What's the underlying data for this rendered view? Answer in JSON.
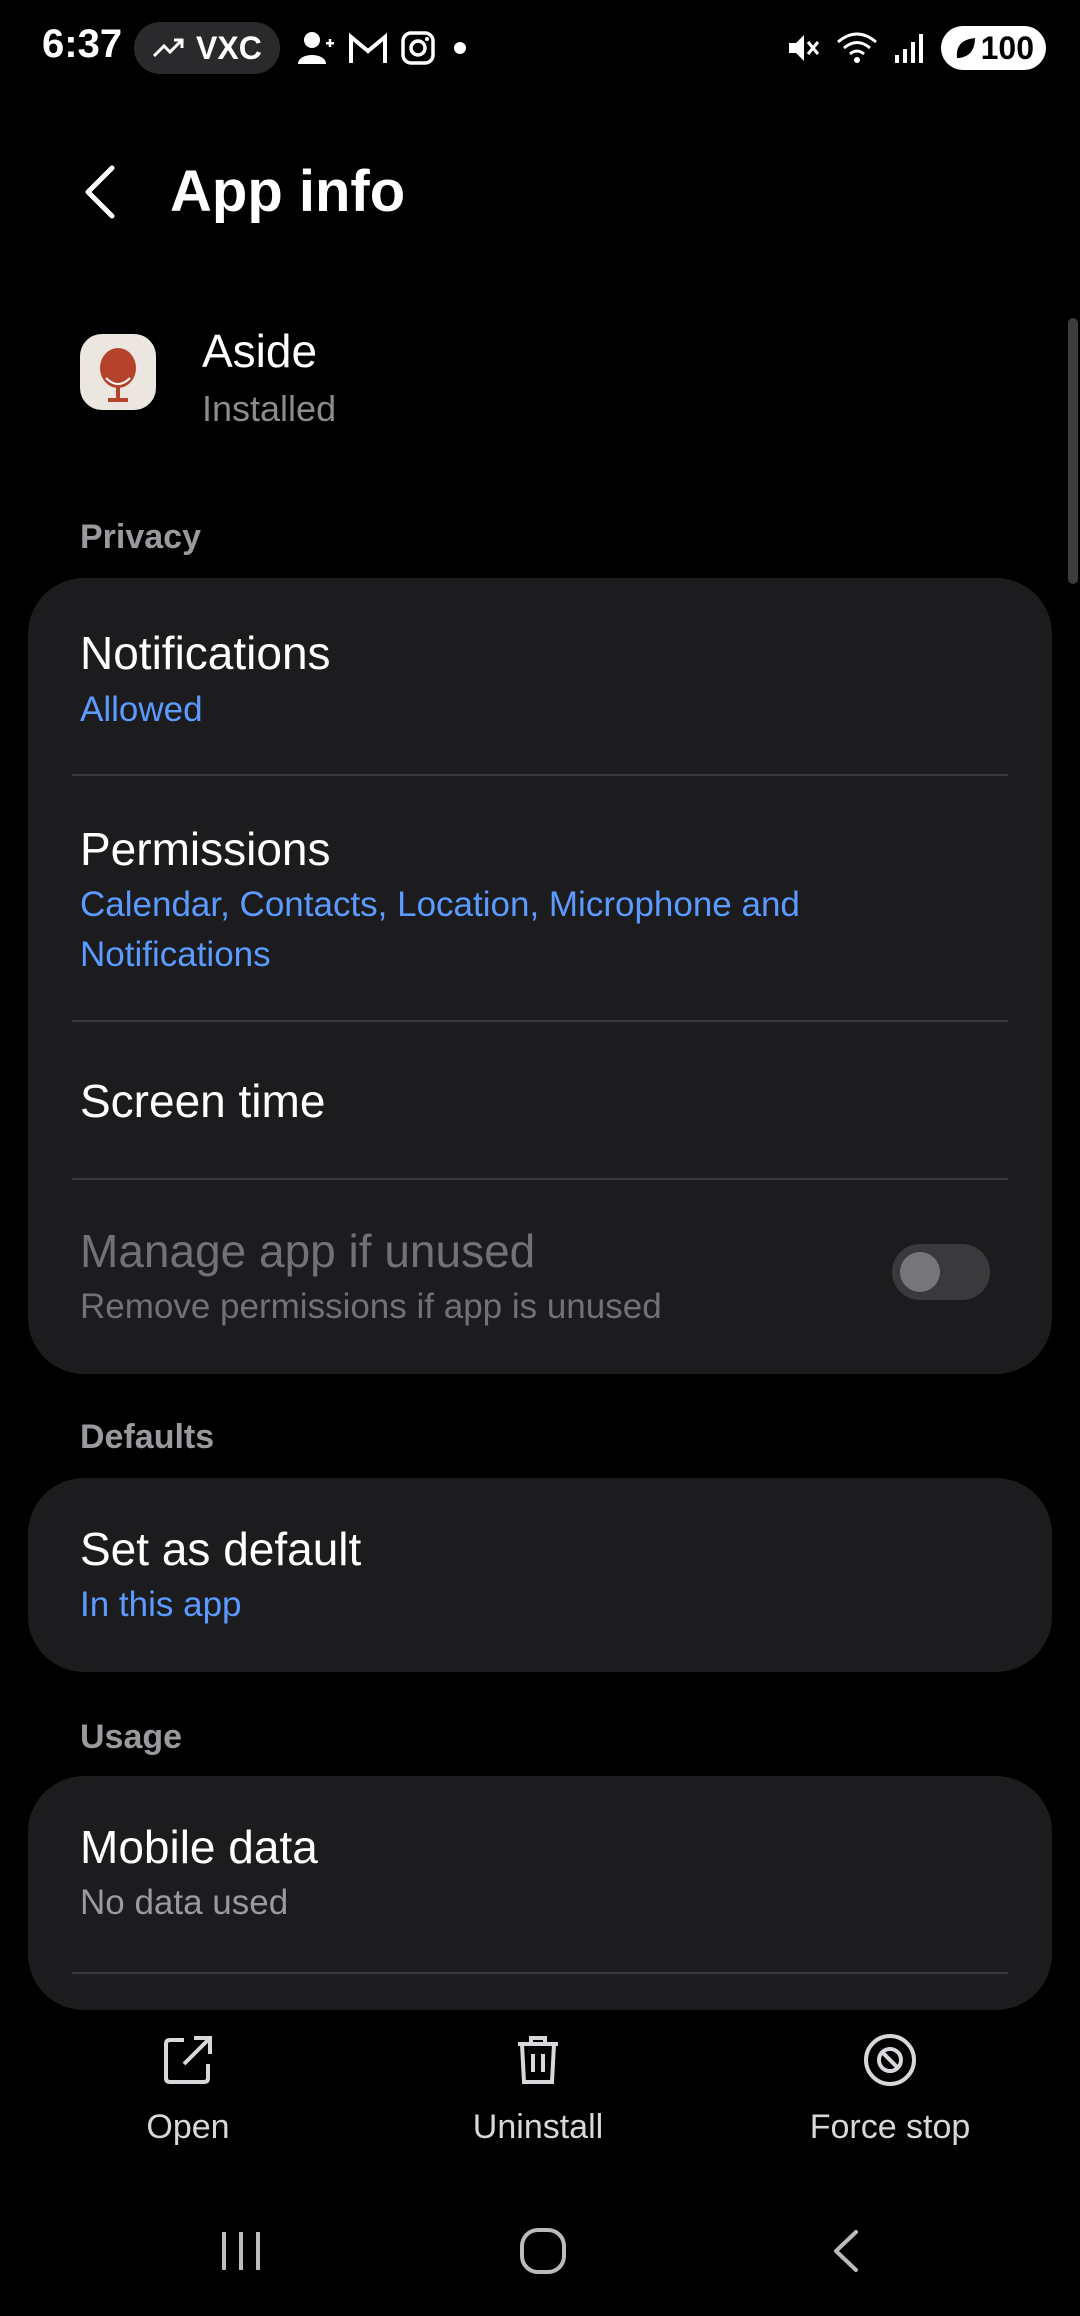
{
  "status_bar": {
    "time": "6:37",
    "pill_text": "VXC",
    "battery": "100"
  },
  "header": {
    "title": "App info"
  },
  "app": {
    "name": "Aside",
    "status": "Installed"
  },
  "sections": {
    "privacy": "Privacy",
    "defaults": "Defaults",
    "usage": "Usage"
  },
  "privacy_items": {
    "notifications_title": "Notifications",
    "notifications_value": "Allowed",
    "permissions_title": "Permissions",
    "permissions_value": "Calendar, Contacts, Location, Microphone and Notifications",
    "screen_time_title": "Screen time",
    "manage_title": "Manage app if unused",
    "manage_sub": "Remove permissions if app is unused",
    "manage_enabled": false
  },
  "defaults_items": {
    "set_default_title": "Set as default",
    "set_default_value": "In this app"
  },
  "usage_items": {
    "mobile_data_title": "Mobile data",
    "mobile_data_value": "No data used"
  },
  "actions": {
    "open": "Open",
    "uninstall": "Uninstall",
    "force_stop": "Force stop"
  },
  "colors": {
    "accent_blue": "#5b9bff",
    "card_bg": "#1c1c1e",
    "app_icon_red": "#b5432c"
  }
}
